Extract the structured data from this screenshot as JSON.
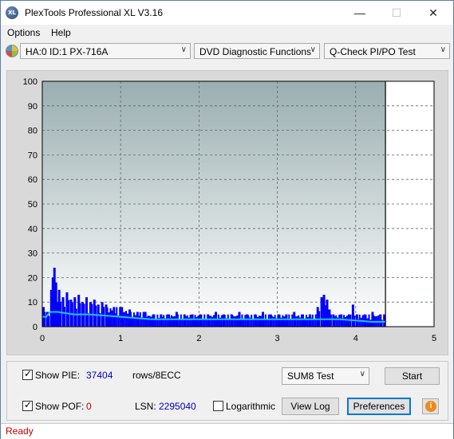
{
  "window": {
    "title": "PlexTools Professional XL V3.16",
    "app_icon_text": "XL"
  },
  "menu": {
    "options": "Options",
    "help": "Help"
  },
  "toolbar": {
    "drive": "HA:0 ID:1  PX-716A",
    "function": "DVD Diagnostic Functions",
    "test": "Q-Check PI/PO Test"
  },
  "chart_data": {
    "type": "bar",
    "x_ticks": [
      "0",
      "1",
      "2",
      "3",
      "4",
      "5"
    ],
    "y_ticks": [
      "0",
      "10",
      "20",
      "30",
      "40",
      "50",
      "60",
      "70",
      "80",
      "90",
      "100"
    ],
    "xlim": [
      0,
      5
    ],
    "ylim": [
      0,
      100
    ],
    "grid": true,
    "scan_end_x": 4.38,
    "colors": {
      "bars": "#0000ff",
      "line": "#19c8e6",
      "bg_top": "#9aaeb0",
      "bg_bottom": "#ffffff"
    },
    "series": [
      {
        "values": [
          [
            0.0,
            8
          ],
          [
            0.05,
            6
          ],
          [
            0.1,
            15
          ],
          [
            0.12,
            20
          ],
          [
            0.14,
            24
          ],
          [
            0.16,
            18
          ],
          [
            0.18,
            10
          ],
          [
            0.2,
            15
          ],
          [
            0.25,
            12
          ],
          [
            0.3,
            14
          ],
          [
            0.35,
            11
          ],
          [
            0.4,
            12
          ],
          [
            0.45,
            13
          ],
          [
            0.5,
            10
          ],
          [
            0.55,
            12
          ],
          [
            0.6,
            10
          ],
          [
            0.65,
            11
          ],
          [
            0.7,
            9
          ],
          [
            0.75,
            10
          ],
          [
            0.8,
            9
          ],
          [
            0.9,
            8
          ],
          [
            1.0,
            8
          ],
          [
            1.1,
            7
          ],
          [
            1.2,
            6
          ],
          [
            1.3,
            6
          ],
          [
            1.4,
            5
          ],
          [
            1.5,
            5
          ],
          [
            1.6,
            5
          ],
          [
            1.7,
            6
          ],
          [
            1.8,
            5
          ],
          [
            1.9,
            5
          ],
          [
            2.0,
            5
          ],
          [
            2.1,
            5
          ],
          [
            2.2,
            6
          ],
          [
            2.3,
            5
          ],
          [
            2.4,
            5
          ],
          [
            2.5,
            6
          ],
          [
            2.6,
            5
          ],
          [
            2.7,
            5
          ],
          [
            2.8,
            6
          ],
          [
            2.9,
            5
          ],
          [
            3.0,
            5
          ],
          [
            3.1,
            5
          ],
          [
            3.2,
            6
          ],
          [
            3.3,
            5
          ],
          [
            3.4,
            5
          ],
          [
            3.5,
            8
          ],
          [
            3.55,
            12
          ],
          [
            3.58,
            13
          ],
          [
            3.62,
            11
          ],
          [
            3.65,
            7
          ],
          [
            3.7,
            5
          ],
          [
            3.8,
            5
          ],
          [
            3.9,
            5
          ],
          [
            3.95,
            9
          ],
          [
            4.0,
            5
          ],
          [
            4.1,
            5
          ],
          [
            4.2,
            6
          ],
          [
            4.3,
            5
          ],
          [
            4.35,
            5
          ]
        ]
      },
      {
        "values": [
          [
            0.0,
            4
          ],
          [
            0.05,
            4
          ],
          [
            0.1,
            6
          ],
          [
            0.2,
            6
          ],
          [
            0.4,
            5
          ],
          [
            0.6,
            5
          ],
          [
            0.8,
            4.5
          ],
          [
            1.0,
            4
          ],
          [
            1.2,
            3.5
          ],
          [
            1.4,
            3
          ],
          [
            1.6,
            3
          ],
          [
            1.8,
            3
          ],
          [
            2.0,
            3
          ],
          [
            2.2,
            3
          ],
          [
            2.4,
            3
          ],
          [
            2.6,
            3
          ],
          [
            2.8,
            3
          ],
          [
            3.0,
            3
          ],
          [
            3.2,
            3
          ],
          [
            3.4,
            3
          ],
          [
            3.6,
            3
          ],
          [
            3.8,
            3
          ],
          [
            4.0,
            2.5
          ],
          [
            4.2,
            2
          ],
          [
            4.38,
            2
          ]
        ]
      }
    ]
  },
  "bottom": {
    "show_pie_label": "Show PIE:",
    "pie_value": "37404",
    "pie_unit": "rows/8ECC",
    "show_pof_label": "Show POF:",
    "pof_value": "0",
    "lsn_label": "LSN:",
    "lsn_value": "2295040",
    "logarithmic_label": "Logarithmic",
    "sum_test": "SUM8 Test",
    "start": "Start",
    "view_log": "View Log",
    "preferences": "Preferences",
    "info_icon_text": "i",
    "checkmark": "✓"
  },
  "status": {
    "text": "Ready"
  }
}
